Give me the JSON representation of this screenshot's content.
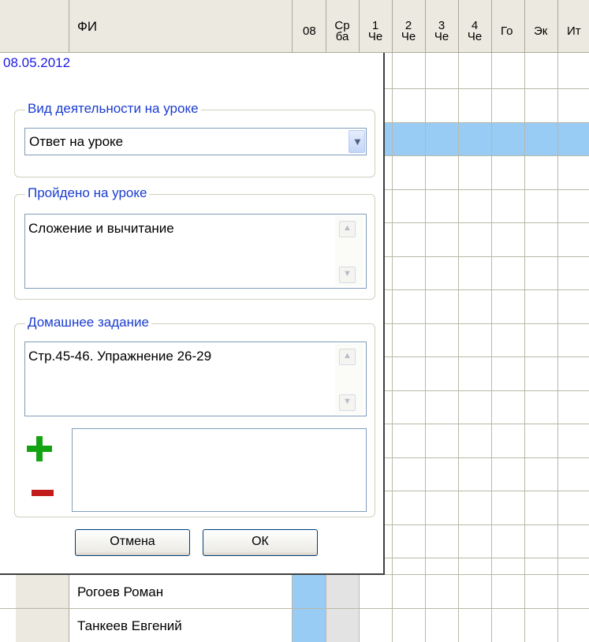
{
  "grid": {
    "header": {
      "name_col": "ФИ",
      "columns": [
        "08",
        "Ср ба",
        "1 Че",
        "2 Че",
        "3 Че",
        "4 Че",
        "Го",
        "Эк",
        "Ит"
      ]
    },
    "rows": [
      {
        "name": "Рогоев Роман"
      },
      {
        "name": "Танкеев Евгений"
      }
    ]
  },
  "popup": {
    "date": "08.05.2012",
    "activity": {
      "title": "Вид деятельности на уроке",
      "selected": "Ответ на уроке"
    },
    "covered": {
      "title": "Пройдено на уроке",
      "text": "Сложение и вычитание"
    },
    "homework": {
      "title": "Домашнее задание",
      "text": "Стр.45-46. Упражнение 26-29",
      "attachments_text": ""
    },
    "buttons": {
      "cancel": "Отмена",
      "ok": "ОК"
    }
  },
  "colors": {
    "selected_row": "#99ccf4",
    "group_title": "#1a3ccf",
    "date_text": "#1a1ae6",
    "add_icon": "#13a313",
    "remove_icon": "#c21c1c"
  }
}
